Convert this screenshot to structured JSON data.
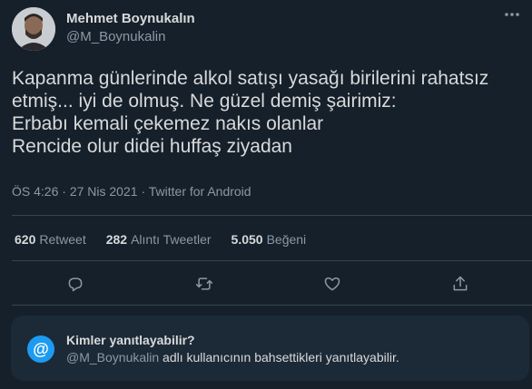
{
  "author": {
    "name": "Mehmet Boynukalın",
    "handle": "@M_Boynukalin"
  },
  "tweet": {
    "lines": [
      "Kapanma günlerinde alkol satışı yasağı birilerini rahatsız",
      "etmiş... iyi de olmuş. Ne güzel demiş şairimiz:",
      "Erbabı kemali çekemez nakıs olanlar",
      "Rencide olur didei huffaş ziyadan"
    ],
    "time": "ÖS 4:26",
    "date": "27 Nis 2021",
    "source": "Twitter for Android",
    "separator": "·"
  },
  "stats": {
    "retweets_count": "620",
    "retweets_label": "Retweet",
    "quotes_count": "282",
    "quotes_label": "Alıntı Tweetler",
    "likes_count": "5.050",
    "likes_label": "Beğeni"
  },
  "reply_card": {
    "title": "Kimler yanıtlayabilir?",
    "mention": "@M_Boynukalin",
    "subtitle_rest": " adlı kullanıcının bahsettikleri yanıtlayabilir.",
    "icon_glyph": "@"
  },
  "icons": {
    "more": "more-icon",
    "reply": "reply-icon",
    "retweet": "retweet-icon",
    "like": "heart-icon",
    "share": "share-icon"
  },
  "colors": {
    "background": "#15202b",
    "accent": "#1d9bf0",
    "muted": "#8b98a5",
    "text": "#d9d9d9"
  }
}
